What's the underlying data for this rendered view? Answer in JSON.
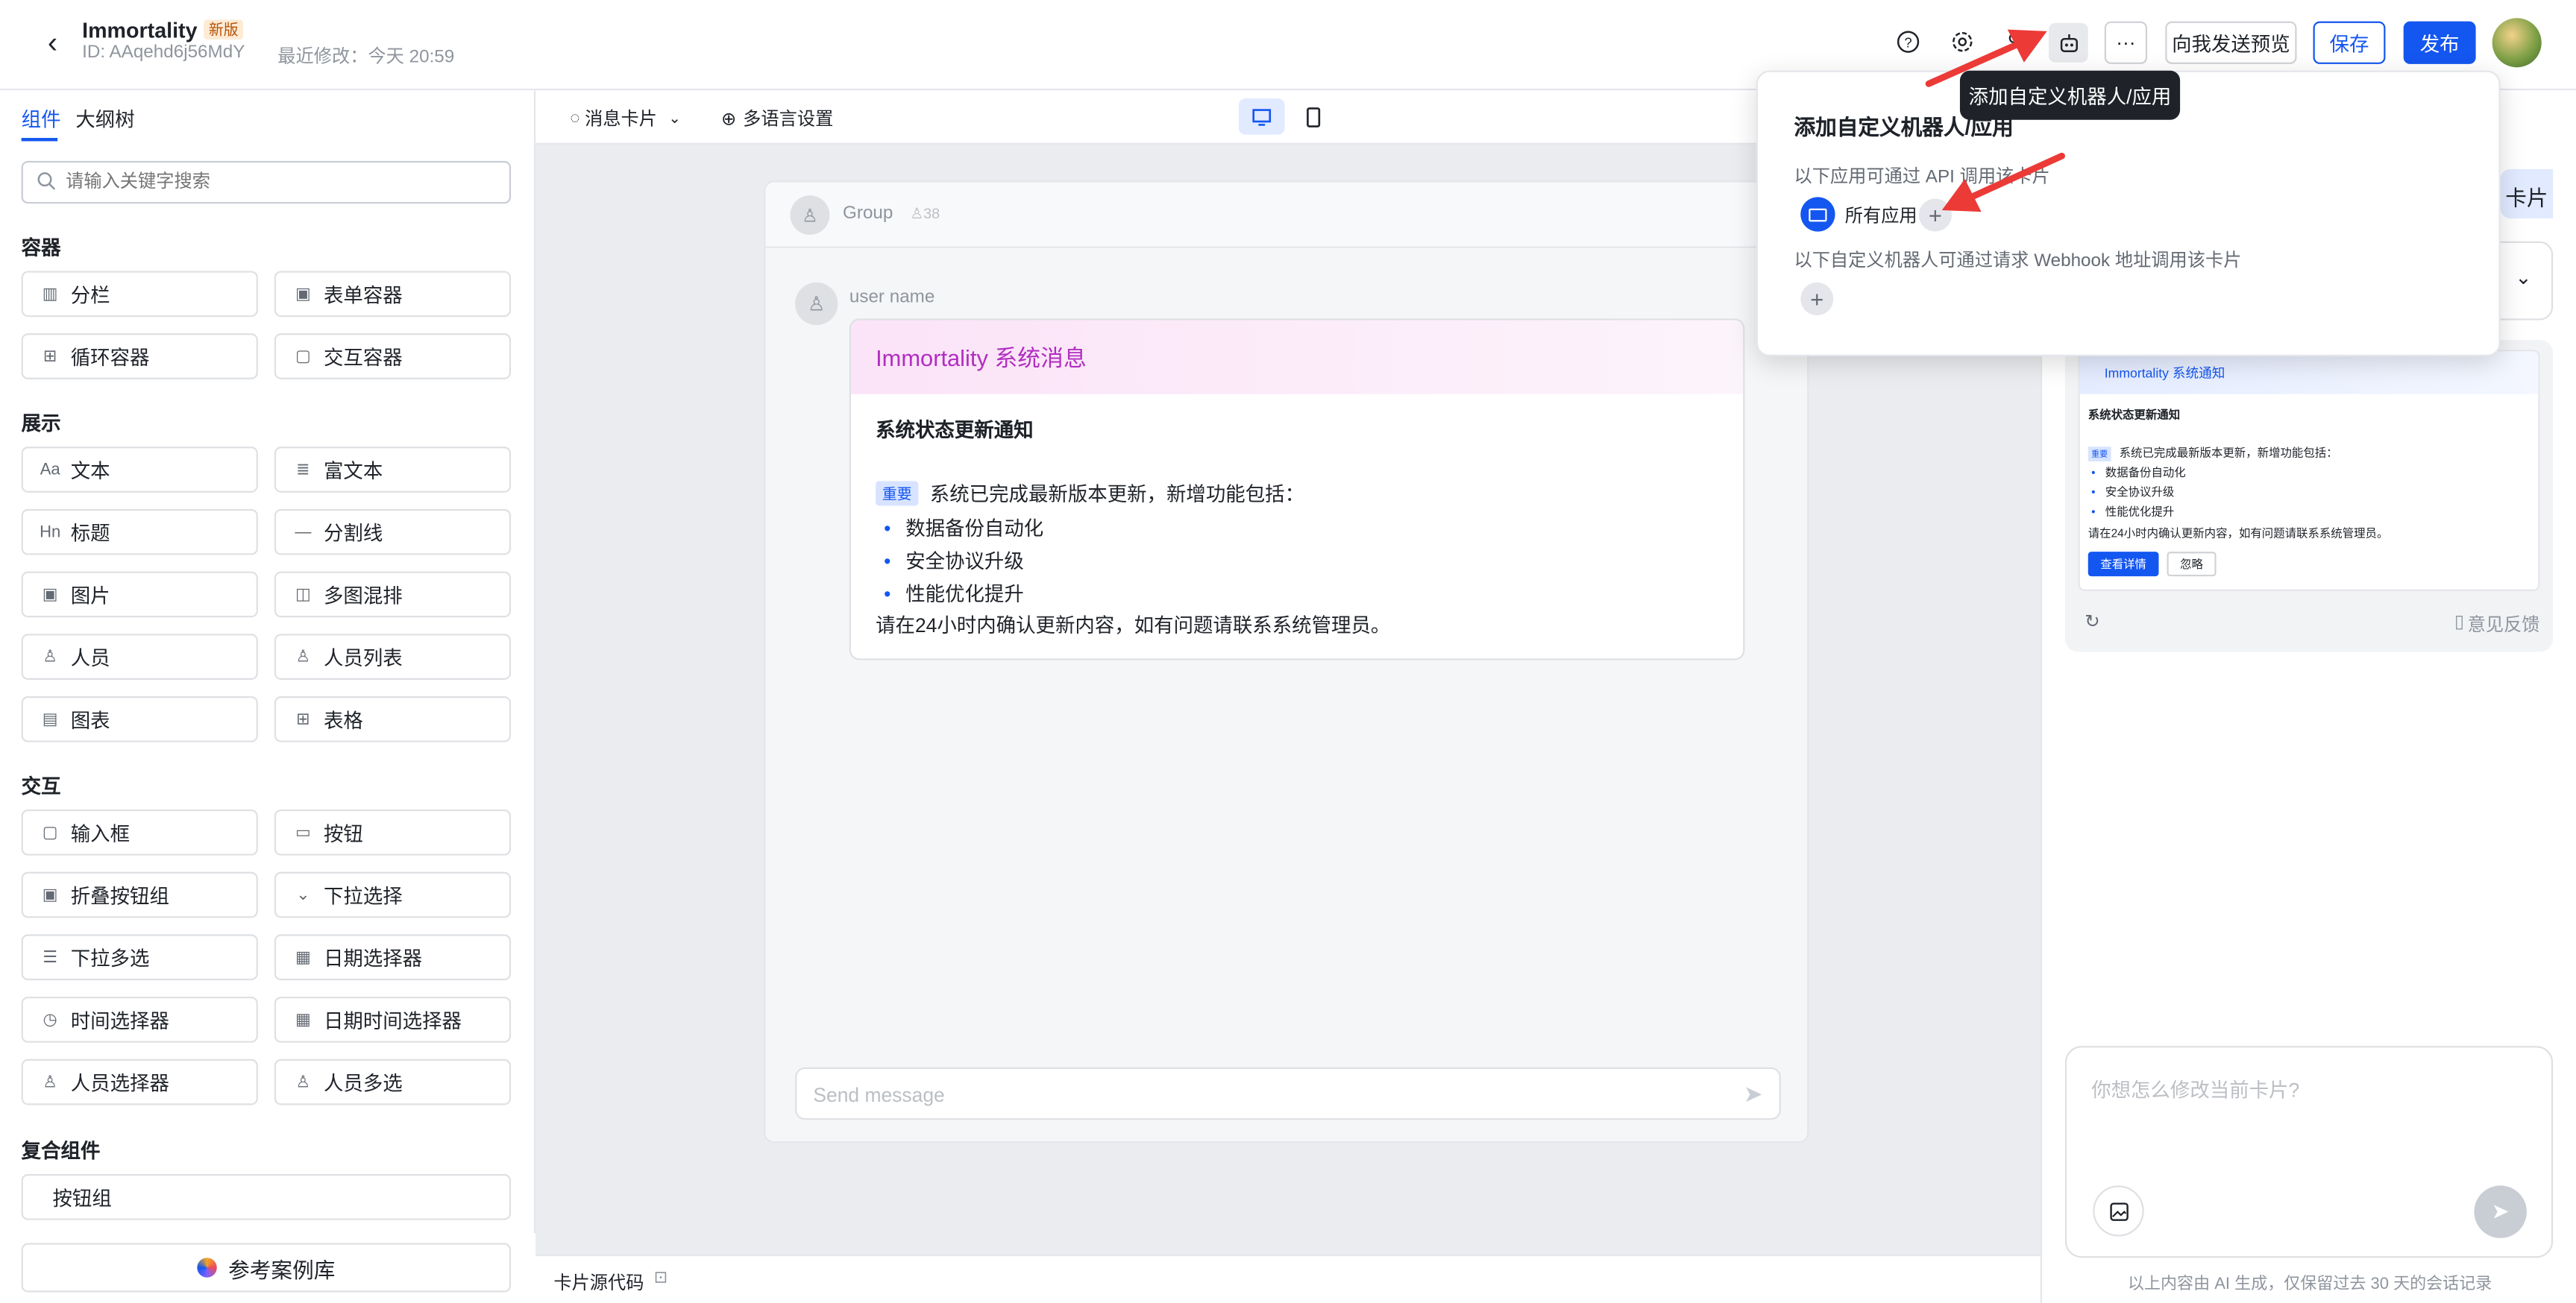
{
  "header": {
    "title": "Immortality",
    "badge": "新版",
    "id_text": "ID: AAqehd6j56MdY",
    "modified": "最近修改：今天 20:59",
    "preview_label": "向我发送预览",
    "save_label": "保存",
    "publish_label": "发布"
  },
  "left": {
    "tabs": [
      "组件",
      "大纲树"
    ],
    "search_placeholder": "请输入关键字搜索",
    "sections": {
      "container": "容器",
      "display": "展示",
      "interact": "交互",
      "composite": "复合组件"
    },
    "items": {
      "fenlan": "分栏",
      "biaodan": "表单容器",
      "xunhuan": "循环容器",
      "jiaohu": "交互容器",
      "wenben": "文本",
      "fuwenben": "富文本",
      "biaoti": "标题",
      "fengexian": "分割线",
      "tupian": "图片",
      "duotu": "多图混排",
      "renyuan": "人员",
      "renyuanliebiao": "人员列表",
      "tubiao": "图表",
      "biaoge": "表格",
      "shurukuang": "输入框",
      "anniu": "按钮",
      "zhedie": "折叠按钮组",
      "xiala": "下拉选择",
      "xialaduoxuan": "下拉多选",
      "riqi": "日期选择器",
      "shijian": "时间选择器",
      "riqishijian": "日期时间选择器",
      "renyuanxuanze": "人员选择器",
      "renyuanduoxuan": "人员多选",
      "anniuzu": "按钮组"
    },
    "case_library": "参考案例库"
  },
  "center": {
    "card_type": "消息卡片",
    "lang_settings": "多语言设置",
    "group_name": "Group",
    "member_count": "38",
    "user_name": "user name",
    "card_title": "Immortality 系统消息",
    "card_heading": "系统状态更新通知",
    "important_tag": "重要",
    "body_line": "系统已完成最新版本更新，新增功能包括：",
    "bullets": [
      "数据备份自动化",
      "安全协议升级",
      "性能优化提升"
    ],
    "footer_line": "请在24小时内确认更新内容，如有问题请联系系统管理员。",
    "send_placeholder": "Send message",
    "source_code": "卡片源代码"
  },
  "popup": {
    "title": "添加自定义机器人/应用",
    "api_text": "以下应用可通过 API 调用该卡片",
    "all_apps": "所有应用",
    "webhook_text": "以下自定义机器人可通过请求 Webhook 地址调用该卡片",
    "tooltip": "添加自定义机器人/应用"
  },
  "right": {
    "peek_text": "卡片",
    "mini_title": "Immortality 系统通知",
    "mini_heading": "系统状态更新通知",
    "mini_tag": "重要",
    "mini_body": "系统已完成最新版本更新，新增功能包括：",
    "mini_bullets": [
      "数据备份自动化",
      "安全协议升级",
      "性能优化提升"
    ],
    "mini_footer": "请在24小时内确认更新内容，如有问题请联系系统管理员。",
    "mini_btn_primary": "查看详情",
    "mini_btn_secondary": "忽略",
    "feedback": "意见反馈",
    "input_placeholder": "你想怎么修改当前卡片?",
    "disclaimer": "以上内容由 AI 生成，仅保留过去 30 天的会话记录"
  },
  "colors": {
    "primary": "#1456f0",
    "purple": "#b12ec0",
    "arrow": "#ec3a37"
  }
}
